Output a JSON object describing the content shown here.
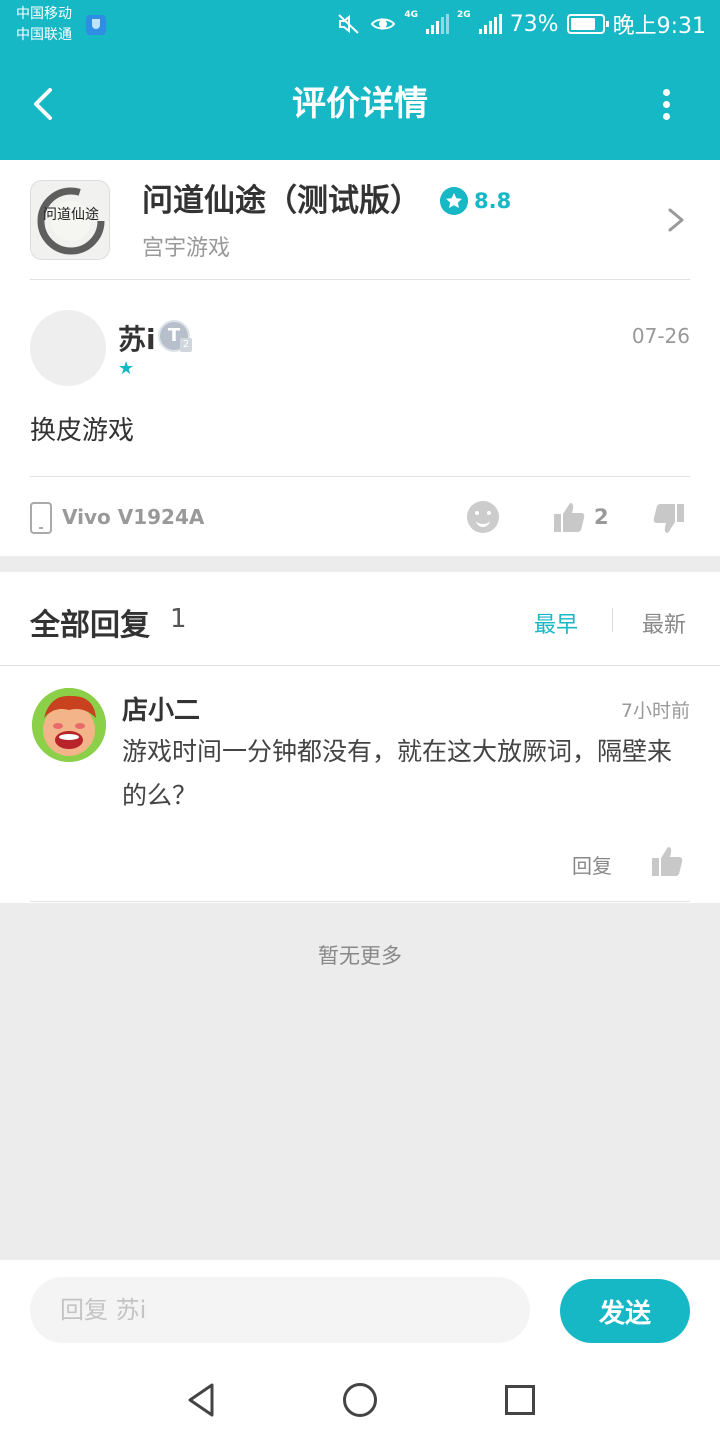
{
  "status_bar": {
    "carrier_1": "中国移动",
    "carrier_2": "中国联通",
    "net_1": "4G",
    "net_2": "2G",
    "battery": "73%",
    "time": "晚上9:31"
  },
  "header": {
    "title": "评价详情",
    "back_icon": "back-arrow-icon",
    "more_icon": "more-vertical-icon"
  },
  "game": {
    "name": "问道仙途（测试版）",
    "score": "8.8",
    "developer": "宫宇游戏",
    "icon_text": "问道仙途"
  },
  "review": {
    "user_name": "苏i",
    "badge": "T",
    "badge_level": "2",
    "star_rating": 1,
    "date": "07-26",
    "content": "换皮游戏",
    "device": "Vivo V1924A",
    "like_count": "2"
  },
  "replies": {
    "title": "全部回复",
    "count": "1",
    "sort_earliest": "最早",
    "sort_latest": "最新",
    "items": [
      {
        "user_name": "店小二",
        "time": "7小时前",
        "content": "游戏时间一分钟都没有，就在这大放厥词，隔壁来的么？",
        "reply_label": "回复"
      }
    ],
    "no_more": "暂无更多"
  },
  "bottom": {
    "input_placeholder": "回复 苏i",
    "send_label": "发送"
  },
  "colors": {
    "accent": "#16b8c6",
    "background_grey": "#ececec"
  }
}
